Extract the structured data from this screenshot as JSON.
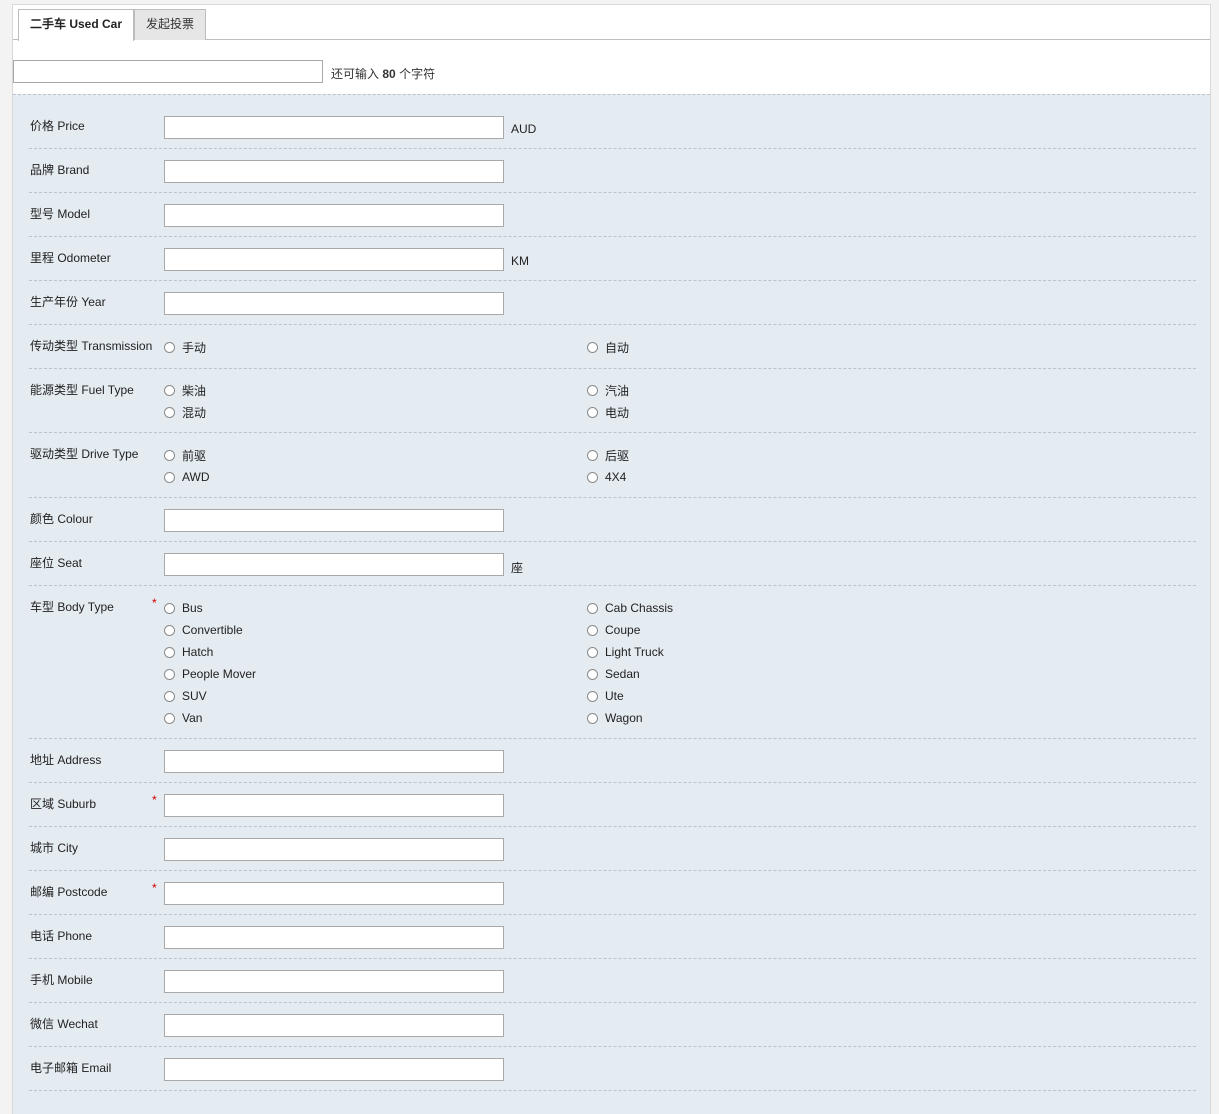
{
  "tabs": [
    {
      "label": "二手车 Used Car",
      "active": true
    },
    {
      "label": "发起投票",
      "active": false
    }
  ],
  "title_input": {
    "value": "",
    "placeholder": ""
  },
  "counter": {
    "prefix": "还可输入",
    "count": "80",
    "suffix": "个字符"
  },
  "colors": {
    "panel_bg": "#e4ebf1",
    "required": "#d20000",
    "divider": "#b9c4ce"
  },
  "fields": {
    "price": {
      "label": "价格 Price",
      "unit": "AUD",
      "value": ""
    },
    "brand": {
      "label": "品牌 Brand",
      "value": ""
    },
    "model": {
      "label": "型号 Model",
      "value": ""
    },
    "odometer": {
      "label": "里程 Odometer",
      "unit": "KM",
      "value": ""
    },
    "year": {
      "label": "生产年份 Year",
      "value": ""
    },
    "transmission": {
      "label": "传动类型 Transmission",
      "options": [
        "手动",
        "自动"
      ]
    },
    "fuel_type": {
      "label": "能源类型 Fuel Type",
      "options": [
        "柴油",
        "汽油",
        "混动",
        "电动"
      ]
    },
    "drive_type": {
      "label": "驱动类型 Drive Type",
      "options": [
        "前驱",
        "后驱",
        "AWD",
        "4X4"
      ]
    },
    "colour": {
      "label": "颜色 Colour",
      "value": ""
    },
    "seat": {
      "label": "座位 Seat",
      "unit": "座",
      "value": ""
    },
    "body_type": {
      "label": "车型 Body Type",
      "required": "*",
      "options": [
        "Bus",
        "Cab Chassis",
        "Convertible",
        "Coupe",
        "Hatch",
        "Light Truck",
        "People Mover",
        "Sedan",
        "SUV",
        "Ute",
        "Van",
        "Wagon"
      ]
    },
    "address": {
      "label": "地址 Address",
      "value": ""
    },
    "suburb": {
      "label": "区域 Suburb",
      "required": "*",
      "value": ""
    },
    "city": {
      "label": "城市 City",
      "value": ""
    },
    "postcode": {
      "label": "邮编 Postcode",
      "required": "*",
      "value": ""
    },
    "phone": {
      "label": "电话 Phone",
      "value": ""
    },
    "mobile": {
      "label": "手机 Mobile",
      "value": ""
    },
    "wechat": {
      "label": "微信 Wechat",
      "value": ""
    },
    "email": {
      "label": "电子邮箱 Email",
      "value": ""
    }
  }
}
